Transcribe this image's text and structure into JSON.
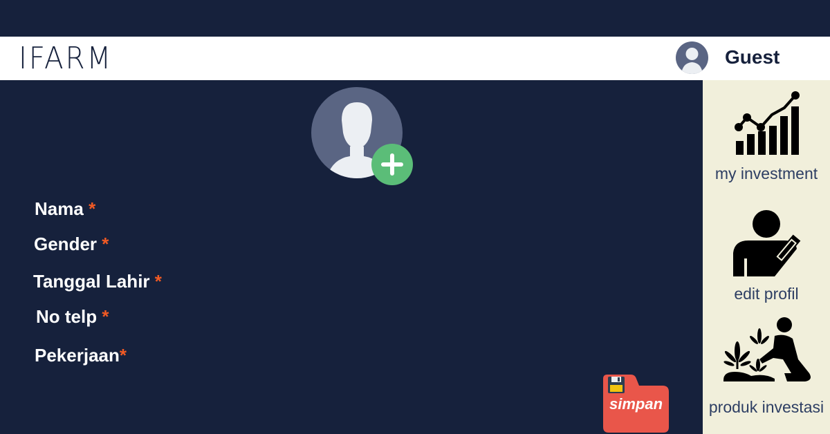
{
  "header": {
    "logo_text": "IFARM",
    "user_name": "Guest"
  },
  "sidebar": {
    "items": [
      {
        "label": "my investment",
        "icon": "growth-chart-icon"
      },
      {
        "label": "edit profil",
        "icon": "user-edit-icon"
      },
      {
        "label": "produk investasi",
        "icon": "farmer-planting-icon"
      }
    ]
  },
  "form": {
    "fields": [
      {
        "label": "Nama",
        "required_mark": "*"
      },
      {
        "label": "Gender",
        "required_mark": "*"
      },
      {
        "label": "Tanggal Lahir",
        "required_mark": "*"
      },
      {
        "label": "No telp",
        "required_mark": "*"
      },
      {
        "label": "Pekerjaan",
        "required_mark": "*"
      }
    ],
    "save_label": "simpan"
  },
  "colors": {
    "background": "#16213c",
    "header_bg": "#ffffff",
    "sidebar_bg": "#f1efdb",
    "accent_required": "#f15a24",
    "add_button": "#5bbd78",
    "save_button": "#e9564a"
  }
}
